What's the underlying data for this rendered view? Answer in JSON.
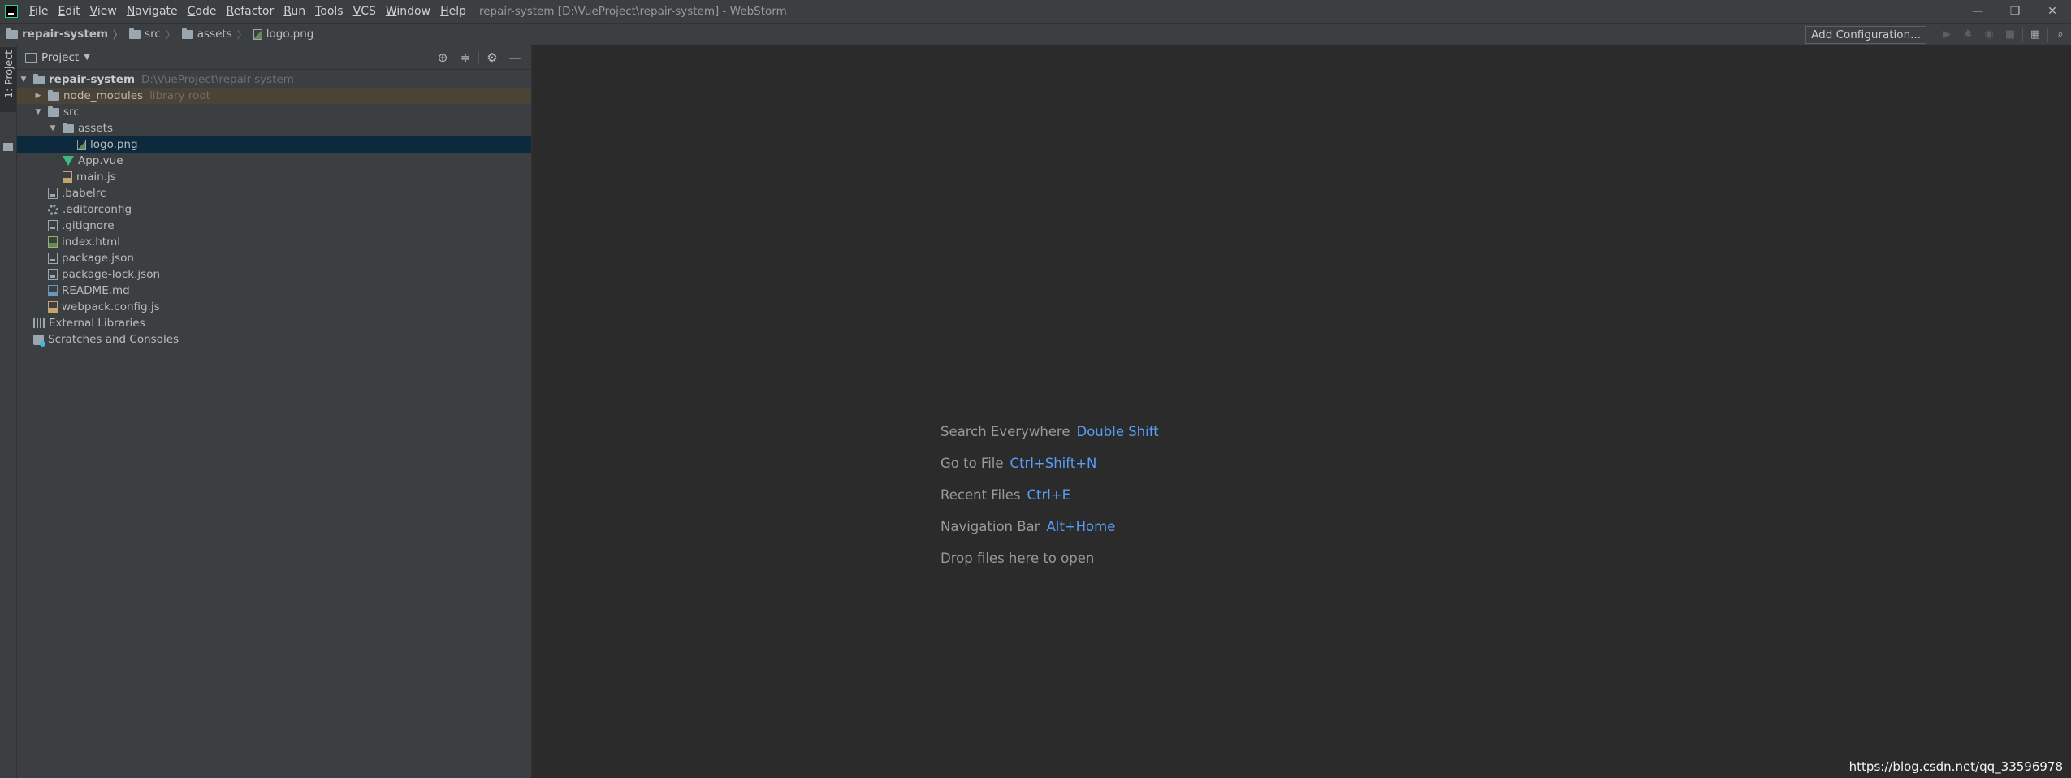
{
  "titlebar": {
    "menu": [
      {
        "u": "F",
        "rest": "ile"
      },
      {
        "u": "E",
        "rest": "dit"
      },
      {
        "u": "V",
        "rest": "iew"
      },
      {
        "u": "N",
        "rest": "avigate"
      },
      {
        "u": "C",
        "rest": "ode"
      },
      {
        "u": "R",
        "rest": "efactor"
      },
      {
        "u": "R",
        "rest": "un"
      },
      {
        "u": "T",
        "rest": "ools"
      },
      {
        "u": "V",
        "rest": "CS"
      },
      {
        "u": "W",
        "rest": "indow"
      },
      {
        "u": "H",
        "rest": "elp"
      }
    ],
    "window_title": "repair-system [D:\\VueProject\\repair-system] - WebStorm",
    "controls": {
      "minimize": "—",
      "restore": "❐",
      "close": "✕"
    }
  },
  "navbar": {
    "crumbs": [
      "repair-system",
      "src",
      "assets",
      "logo.png"
    ],
    "add_configuration": "Add Configuration...",
    "toolbar_icons": [
      "run-icon",
      "debug-icon",
      "coverage-icon",
      "stop-icon",
      "project-structure-icon",
      "search-icon"
    ]
  },
  "stripe": {
    "project_tab": "1: Project"
  },
  "project_panel": {
    "title": "Project",
    "tree": {
      "root": {
        "name": "repair-system",
        "path": "D:\\VueProject\\repair-system"
      },
      "node_modules": {
        "name": "node_modules",
        "hint": "library root"
      },
      "src": "src",
      "assets": "assets",
      "logo": "logo.png",
      "app_vue": "App.vue",
      "main_js": "main.js",
      "babelrc": ".babelrc",
      "editorconfig": ".editorconfig",
      "gitignore": ".gitignore",
      "index_html": "index.html",
      "package_json": "package.json",
      "package_lock": "package-lock.json",
      "readme": "README.md",
      "webpack": "webpack.config.js",
      "external_libs": "External Libraries",
      "scratches": "Scratches and Consoles"
    }
  },
  "editor": {
    "hints": [
      {
        "label": "Search Everywhere",
        "shortcut": "Double Shift"
      },
      {
        "label": "Go to File",
        "shortcut": "Ctrl+Shift+N"
      },
      {
        "label": "Recent Files",
        "shortcut": "Ctrl+E"
      },
      {
        "label": "Navigation Bar",
        "shortcut": "Alt+Home"
      },
      {
        "label": "Drop files here to open",
        "shortcut": ""
      }
    ],
    "watermark": "https://blog.csdn.net/qq_33596978"
  }
}
